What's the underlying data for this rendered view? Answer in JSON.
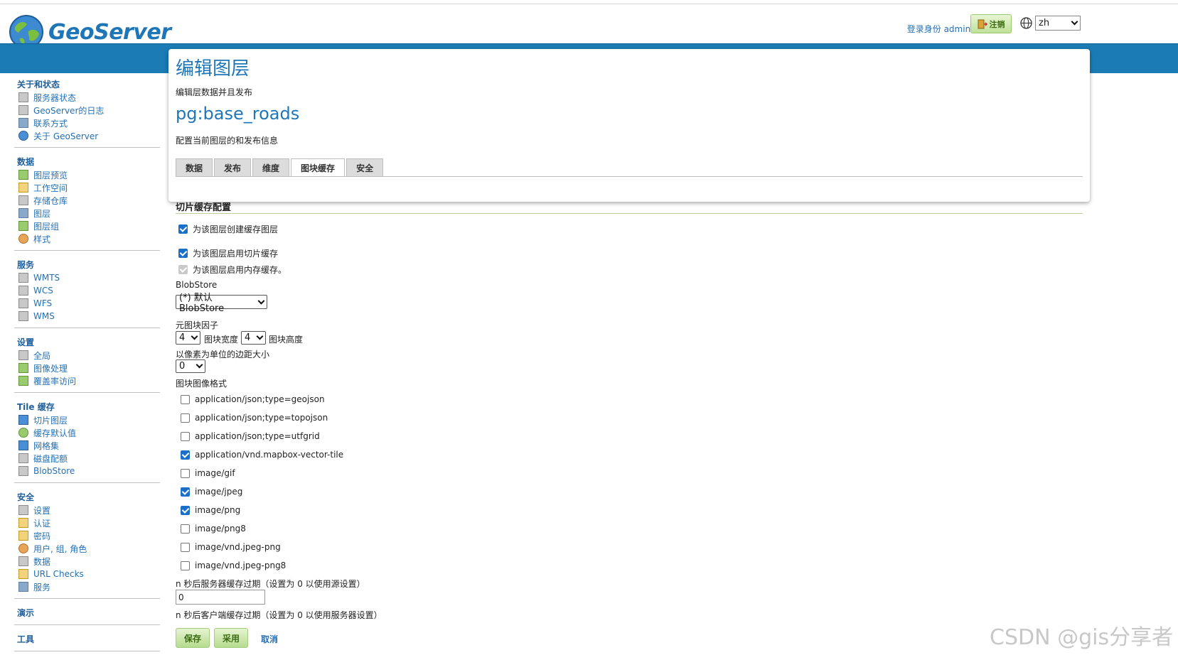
{
  "header": {
    "logo_text": "GeoServer",
    "login_text": "登录身份 admin.",
    "logout_label": "注销",
    "language": "zh"
  },
  "sidebar": {
    "groups": [
      {
        "title": "关于和状态",
        "items": [
          "服务器状态",
          "GeoServer的日志",
          "联系方式",
          "关于 GeoServer"
        ]
      },
      {
        "title": "数据",
        "items": [
          "图层预览",
          "工作空间",
          "存储仓库",
          "图层",
          "图层组",
          "样式"
        ]
      },
      {
        "title": "服务",
        "items": [
          "WMTS",
          "WCS",
          "WFS",
          "WMS"
        ]
      },
      {
        "title": "设置",
        "items": [
          "全局",
          "图像处理",
          "覆盖率访问"
        ]
      },
      {
        "title": "Tile 缓存",
        "items": [
          "切片图层",
          "缓存默认值",
          "网格集",
          "磁盘配额",
          "BlobStore"
        ]
      },
      {
        "title": "安全",
        "items": [
          "设置",
          "认证",
          "密码",
          "用户, 组, 角色",
          "数据",
          "URL Checks",
          "服务"
        ]
      },
      {
        "title": "演示",
        "items": []
      },
      {
        "title": "工具",
        "items": []
      }
    ]
  },
  "main": {
    "page_title": "编辑图层",
    "page_desc": "编辑层数据并且发布",
    "layer_name": "pg:base_roads",
    "layer_desc": "配置当前图层的和发布信息",
    "tabs": [
      "数据",
      "发布",
      "维度",
      "图块缓存",
      "安全"
    ],
    "active_tab": "图块缓存"
  },
  "tile_cache": {
    "section_title": "切片缓存配置",
    "create_cached_layer": {
      "label": "为该图层创建缓存图层",
      "checked": true
    },
    "enable_tile_cache": {
      "label": "为该图层启用切片缓存",
      "checked": true
    },
    "enable_in_memory": {
      "label": "为该图层启用内存缓存。",
      "checked": true,
      "disabled": true
    },
    "blobstore_label": "BlobStore",
    "blobstore_value": "(*) 默认 BlobStore",
    "metatile_label": "元图块因子",
    "metatile_width": "4",
    "metatile_width_label": "图块宽度",
    "metatile_height": "4",
    "metatile_height_label": "图块高度",
    "gutter_label": "以像素为单位的边距大小",
    "gutter_value": "0",
    "formats_label": "图块图像格式",
    "formats": [
      {
        "name": "application/json;type=geojson",
        "checked": false
      },
      {
        "name": "application/json;type=topojson",
        "checked": false
      },
      {
        "name": "application/json;type=utfgrid",
        "checked": false
      },
      {
        "name": "application/vnd.mapbox-vector-tile",
        "checked": true
      },
      {
        "name": "image/gif",
        "checked": false
      },
      {
        "name": "image/jpeg",
        "checked": true
      },
      {
        "name": "image/png",
        "checked": true
      },
      {
        "name": "image/png8",
        "checked": false
      },
      {
        "name": "image/vnd.jpeg-png",
        "checked": false
      },
      {
        "name": "image/vnd.jpeg-png8",
        "checked": false
      }
    ],
    "server_expire_label": "n 秒后服务器缓存过期（设置为 0 以使用源设置）",
    "server_expire_value": "0",
    "client_expire_label": "n 秒后客户端缓存过期（设置为 0 以使用服务器设置）"
  },
  "actions": {
    "save": "保存",
    "apply": "采用",
    "cancel": "取消"
  },
  "watermark": "CSDN @gis分享者"
}
